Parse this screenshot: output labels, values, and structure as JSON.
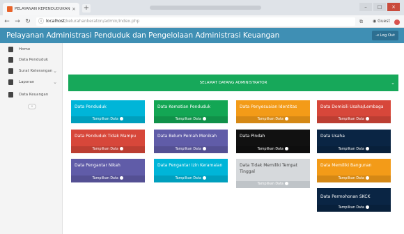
{
  "browser": {
    "tab_title": "PELAYANAN KEPENDUDUKAN",
    "tab_close": "×",
    "new_tab": "+",
    "url_host": "localhost",
    "url_path": "/kelurahankeraton/admin/index.php",
    "profile_label": "Guest",
    "win_minimize": "–",
    "win_maximize": "□",
    "win_close": "×"
  },
  "header": {
    "title": "Pelayanan Administrasi Penduduk dan Pengelolaan Administrasi Keuangan",
    "logout_label": "Log Out"
  },
  "sidebar": {
    "items": [
      {
        "label": "Home",
        "has_submenu": false
      },
      {
        "label": "Data Penduduk",
        "has_submenu": false
      },
      {
        "label": "Surat Keterangan",
        "has_submenu": true
      },
      {
        "label": "Laporan",
        "has_submenu": true
      },
      {
        "label": "Data Keuangan",
        "has_submenu": false
      }
    ],
    "toggle_icon": "«"
  },
  "main": {
    "welcome_text": "SELAMAT DATANG ADMINISTRATOR",
    "cards": [
      {
        "title": "Data Penduduk",
        "link": "Tampilkan Data",
        "color": "#00b5d8"
      },
      {
        "title": "Data Kematian Penduduk",
        "link": "Tampilkan Data",
        "color": "#13a654"
      },
      {
        "title": "Data Penyesuaian Identitas",
        "link": "Tampilkan Data",
        "color": "#f39b18"
      },
      {
        "title": "Data Domisili Usaha/Lembaga",
        "link": "Tampilkan Data",
        "color": "#d7473a"
      },
      {
        "title": "Data Penduduk Tidak Mampu",
        "link": "Tampilkan Data",
        "color": "#d7473a"
      },
      {
        "title": "Data Belum Pernah Menikah",
        "link": "Tampilkan Data",
        "color": "#605ca8"
      },
      {
        "title": "Data Pindah",
        "link": "Tampilkan Data",
        "color": "#111111"
      },
      {
        "title": "Data Usaha",
        "link": "Tampilkan Data",
        "color": "#0a2544"
      },
      {
        "title": "Data Pengantar Nikah",
        "link": "Tampilkan Data",
        "color": "#605ca8"
      },
      {
        "title": "Data Pengantar Izin Keramaian",
        "link": "Tampilkan Data",
        "color": "#00b5d8"
      },
      {
        "title": "Data Tidak Memiliki Tempat Tinggal",
        "link": "Tampilkan Data",
        "color": "#d6d9dc"
      },
      {
        "title": "Data Memiliki Bangunan",
        "link": "Tampilkan Data",
        "color": "#f39b18"
      },
      {
        "title": "Data Permohonan SKCK",
        "link": "Tampilkan Data",
        "color": "#0a2544"
      }
    ]
  }
}
